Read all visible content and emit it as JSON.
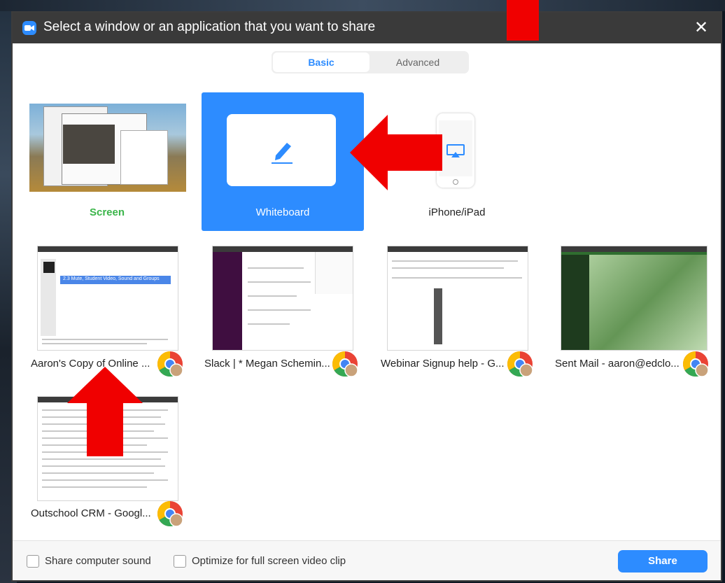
{
  "dialog": {
    "title": "Select a window or an application that you want to share",
    "close_glyph": "✕"
  },
  "tabs": [
    {
      "label": "Basic",
      "selected": true
    },
    {
      "label": "Advanced",
      "selected": false
    }
  ],
  "options": {
    "screen_label": "Screen",
    "whiteboard_label": "Whiteboard",
    "iphone_label": "iPhone/iPad"
  },
  "apps": [
    {
      "label": "Aaron's Copy of Online ...",
      "icon": "chrome-icon"
    },
    {
      "label": "Slack | * Megan Schemin...",
      "icon": "chrome-icon"
    },
    {
      "label": "Webinar Signup help - G...",
      "icon": "chrome-icon"
    },
    {
      "label": "Sent Mail - aaron@edclo...",
      "icon": "chrome-icon"
    },
    {
      "label": "Outschool CRM - Googl...",
      "icon": "chrome-icon"
    }
  ],
  "thumb_text": {
    "t1_highlight": "2.3 Mute, Student Video, Sound and Groups"
  },
  "footer": {
    "share_sound": "Share computer sound",
    "optimize_video": "Optimize for full screen video clip",
    "share_button": "Share"
  },
  "colors": {
    "accent": "#2d8cff",
    "screen_label": "#3bb54a",
    "annotation_arrow": "#f00000"
  }
}
